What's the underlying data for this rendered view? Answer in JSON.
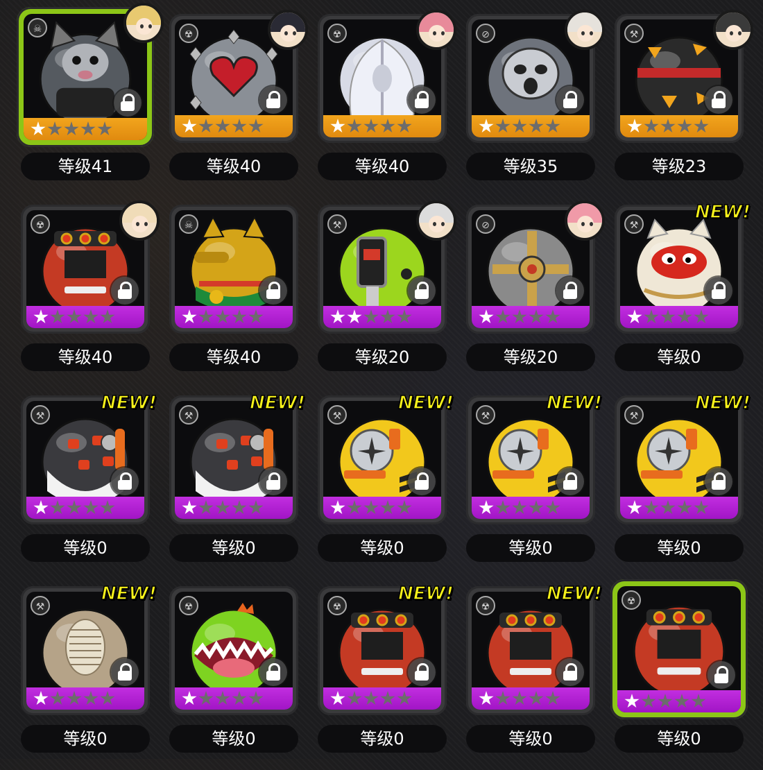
{
  "colors": {
    "selected_border": "#8cc617",
    "footer_orange": "#f2a51d",
    "footer_purple": "#c22ee0",
    "new_badge": "#f7f21a"
  },
  "items": [
    {
      "level": "等级41",
      "stars_filled": 1,
      "stars_total": 5,
      "rarity": "orange",
      "new": false,
      "avatar": true,
      "avatar_hair": "#e8c970",
      "selected": true,
      "type_icon": "bomb-type-icon",
      "art": "grey-cat-ball",
      "art_color": "#555a60",
      "locked": true
    },
    {
      "level": "等级40",
      "stars_filled": 1,
      "stars_total": 5,
      "rarity": "orange",
      "new": false,
      "avatar": true,
      "avatar_hair": "#2a2a34",
      "selected": false,
      "type_icon": "radiation-type-icon",
      "art": "spiked-heart-ball",
      "art_color": "#8a8f96",
      "locked": true
    },
    {
      "level": "等级40",
      "stars_filled": 1,
      "stars_total": 5,
      "rarity": "orange",
      "new": false,
      "avatar": true,
      "avatar_hair": "#e88a9a",
      "selected": false,
      "type_icon": "radiation-type-icon",
      "art": "white-ghost-ball",
      "art_color": "#d8dbe6",
      "locked": true
    },
    {
      "level": "等级35",
      "stars_filled": 1,
      "stars_total": 5,
      "rarity": "orange",
      "new": false,
      "avatar": true,
      "avatar_hair": "#e6e2dc",
      "selected": false,
      "type_icon": "slash-type-icon",
      "art": "stitched-mummy-ball",
      "art_color": "#6e737c",
      "locked": true
    },
    {
      "level": "等级23",
      "stars_filled": 1,
      "stars_total": 5,
      "rarity": "orange",
      "new": false,
      "avatar": true,
      "avatar_hair": "#3a3a3a",
      "selected": false,
      "type_icon": "hammer-type-icon",
      "art": "hazard-stripe-ball",
      "art_color": "#2a2a2a",
      "locked": true
    },
    {
      "level": "等级40",
      "stars_filled": 1,
      "stars_total": 5,
      "rarity": "purple",
      "new": false,
      "avatar": true,
      "avatar_hair": "#f0dcb8",
      "selected": false,
      "type_icon": "radiation-type-icon",
      "art": "red-samurai-ball",
      "art_color": "#c43a24",
      "locked": true
    },
    {
      "level": "等级40",
      "stars_filled": 1,
      "stars_total": 5,
      "rarity": "purple",
      "new": false,
      "avatar": false,
      "selected": false,
      "type_icon": "bomb-type-icon",
      "art": "gold-lucky-cat-ball",
      "art_color": "#d4a418",
      "locked": true
    },
    {
      "level": "等级20",
      "stars_filled": 2,
      "stars_total": 5,
      "rarity": "purple",
      "new": false,
      "avatar": true,
      "avatar_hair": "#dcdcdc",
      "selected": false,
      "type_icon": "hammer-type-icon",
      "art": "green-robot-ball",
      "art_color": "#9cd61e",
      "locked": true
    },
    {
      "level": "等级20",
      "stars_filled": 1,
      "stars_total": 5,
      "rarity": "purple",
      "new": false,
      "avatar": true,
      "avatar_hair": "#f09aa8",
      "selected": false,
      "type_icon": "slash-type-icon",
      "art": "gear-cross-ball",
      "art_color": "#8a8a8a",
      "locked": true
    },
    {
      "level": "等级0",
      "stars_filled": 1,
      "stars_total": 5,
      "rarity": "purple",
      "new": true,
      "new_label": "NEW!",
      "avatar": false,
      "selected": false,
      "type_icon": "hammer-type-icon",
      "art": "white-daruma-cat-ball",
      "art_color": "#efe7d6",
      "locked": true
    },
    {
      "level": "等级0",
      "stars_filled": 1,
      "stars_total": 5,
      "rarity": "purple",
      "new": true,
      "new_label": "NEW!",
      "avatar": false,
      "selected": false,
      "type_icon": "hammer-type-icon",
      "art": "penguin-mech-ball",
      "art_color": "#3a3a3e",
      "locked": true
    },
    {
      "level": "等级0",
      "stars_filled": 1,
      "stars_total": 5,
      "rarity": "purple",
      "new": true,
      "new_label": "NEW!",
      "avatar": false,
      "selected": false,
      "type_icon": "hammer-type-icon",
      "art": "penguin-mech-ball",
      "art_color": "#3a3a3e",
      "locked": true
    },
    {
      "level": "等级0",
      "stars_filled": 1,
      "stars_total": 5,
      "rarity": "purple",
      "new": true,
      "new_label": "NEW!",
      "avatar": false,
      "selected": false,
      "type_icon": "hammer-type-icon",
      "art": "yellow-vault-ball",
      "art_color": "#f2c81c",
      "locked": true
    },
    {
      "level": "等级0",
      "stars_filled": 1,
      "stars_total": 5,
      "rarity": "purple",
      "new": true,
      "new_label": "NEW!",
      "avatar": false,
      "selected": false,
      "type_icon": "hammer-type-icon",
      "art": "yellow-vault-ball",
      "art_color": "#f2c81c",
      "locked": true
    },
    {
      "level": "等级0",
      "stars_filled": 1,
      "stars_total": 5,
      "rarity": "purple",
      "new": true,
      "new_label": "NEW!",
      "avatar": false,
      "selected": false,
      "type_icon": "hammer-type-icon",
      "art": "yellow-vault-ball",
      "art_color": "#f2c81c",
      "locked": true
    },
    {
      "level": "等级0",
      "stars_filled": 1,
      "stars_total": 5,
      "rarity": "purple",
      "new": true,
      "new_label": "NEW!",
      "avatar": false,
      "selected": false,
      "type_icon": "hammer-type-icon",
      "art": "fossil-rock-ball",
      "art_color": "#b5a388",
      "locked": true
    },
    {
      "level": "等级0",
      "stars_filled": 1,
      "stars_total": 5,
      "rarity": "purple",
      "new": false,
      "avatar": false,
      "selected": false,
      "type_icon": "radiation-type-icon",
      "art": "green-chomper-ball",
      "art_color": "#7ed321",
      "locked": true
    },
    {
      "level": "等级0",
      "stars_filled": 1,
      "stars_total": 5,
      "rarity": "purple",
      "new": true,
      "new_label": "NEW!",
      "avatar": false,
      "selected": false,
      "type_icon": "radiation-type-icon",
      "art": "red-samurai-ball",
      "art_color": "#c43a24",
      "locked": true
    },
    {
      "level": "等级0",
      "stars_filled": 1,
      "stars_total": 5,
      "rarity": "purple",
      "new": true,
      "new_label": "NEW!",
      "avatar": false,
      "selected": false,
      "type_icon": "radiation-type-icon",
      "art": "red-samurai-ball",
      "art_color": "#c43a24",
      "locked": true
    },
    {
      "level": "等级0",
      "stars_filled": 1,
      "stars_total": 5,
      "rarity": "purple",
      "new": false,
      "avatar": false,
      "selected": true,
      "type_icon": "radiation-type-icon",
      "art": "red-samurai-ball",
      "art_color": "#c43a24",
      "locked": true
    }
  ]
}
